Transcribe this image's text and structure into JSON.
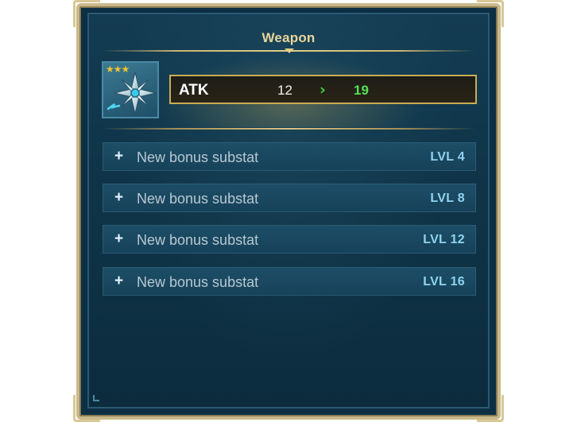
{
  "window": {
    "title": "Weapon"
  },
  "item": {
    "stars": "★★★",
    "icon": "shuriken-weapon-icon"
  },
  "main_stat": {
    "name": "ATK",
    "old_value": "12",
    "arrow": "›",
    "new_value": "19"
  },
  "substats": [
    {
      "plus": "+",
      "label": "New bonus substat",
      "level": "LVL 4"
    },
    {
      "plus": "+",
      "label": "New bonus substat",
      "level": "LVL 8"
    },
    {
      "plus": "+",
      "label": "New bonus substat",
      "level": "LVL 12"
    },
    {
      "plus": "+",
      "label": "New bonus substat",
      "level": "LVL 16"
    }
  ],
  "colors": {
    "accent_gold": "#e8d59b",
    "stat_increase": "#55e055",
    "level_text": "#8fd3f0",
    "panel_bg": "#0f3448"
  }
}
